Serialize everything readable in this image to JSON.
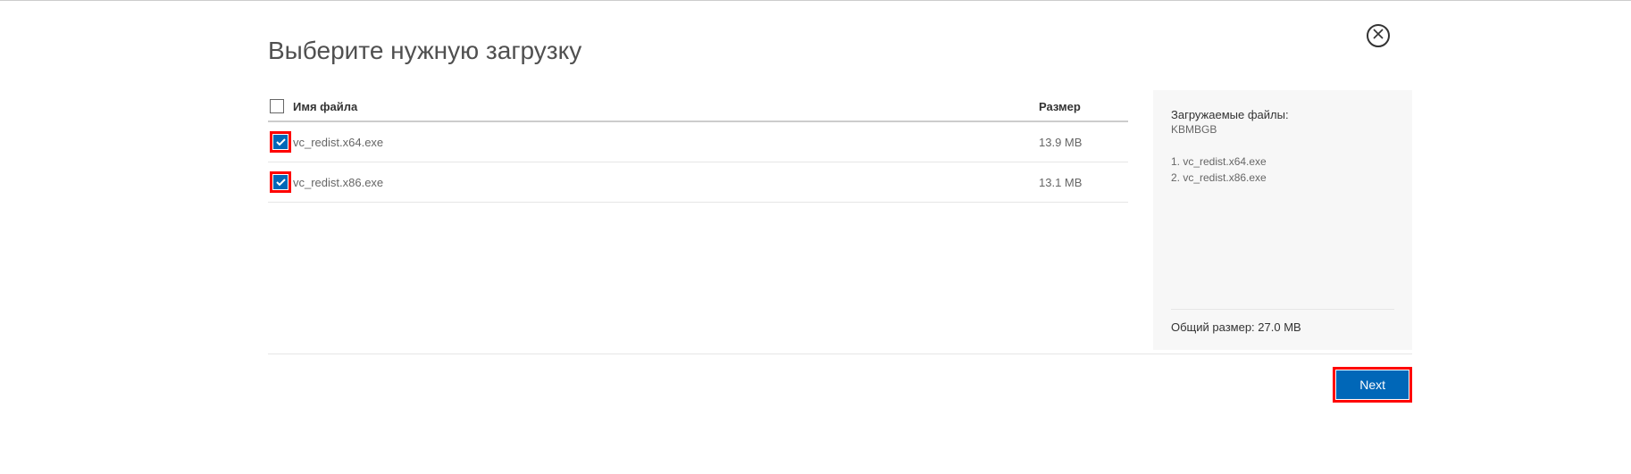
{
  "title": "Выберите нужную загрузку",
  "headers": {
    "name": "Имя файла",
    "size": "Размер"
  },
  "files": [
    {
      "name": "vc_redist.x64.exe",
      "size": "13.9 MB"
    },
    {
      "name": "vc_redist.x86.exe",
      "size": "13.1 MB"
    }
  ],
  "summary": {
    "title": "Загружаемые файлы:",
    "sub": "KBMBGB",
    "list": {
      "item1": "1.  vc_redist.x64.exe",
      "item2": "2.  vc_redist.x86.exe"
    },
    "total": "Общий размер: 27.0 MB"
  },
  "next": "Next"
}
